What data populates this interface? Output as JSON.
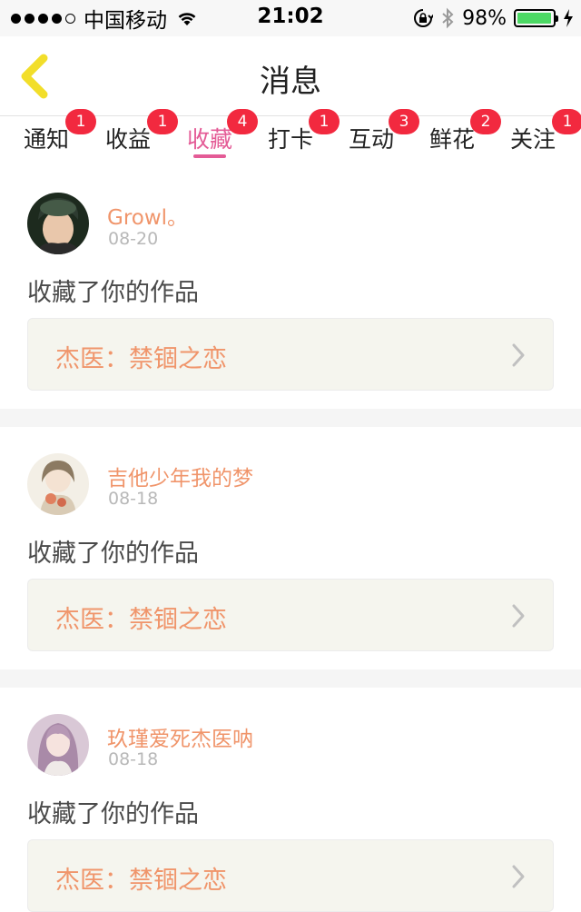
{
  "status_bar": {
    "carrier": "中国移动",
    "time": "21:02",
    "battery_percent": "98%",
    "battery_level": 0.98,
    "battery_color": "#4cd964"
  },
  "nav": {
    "title": "消息",
    "back_icon": "chevron-left-icon",
    "back_color": "#f2de2a"
  },
  "tabs": [
    {
      "label": "通知",
      "badge": "1"
    },
    {
      "label": "收益",
      "badge": "1"
    },
    {
      "label": "收藏",
      "badge": "4",
      "active": true
    },
    {
      "label": "打卡",
      "badge": "1"
    },
    {
      "label": "互动",
      "badge": "3"
    },
    {
      "label": "鲜花",
      "badge": "2"
    },
    {
      "label": "关注",
      "badge": "1"
    }
  ],
  "colors": {
    "accent": "#e45b96",
    "badge": "#f2293f",
    "username": "#f0956b",
    "card_bg": "#f5f5ee"
  },
  "messages": [
    {
      "username": "Growl。",
      "date": "08-20",
      "action": "收藏了你的作品",
      "work_title": "杰医：禁锢之恋"
    },
    {
      "username": "吉他少年我的梦",
      "date": "08-18",
      "action": "收藏了你的作品",
      "work_title": "杰医：禁锢之恋"
    },
    {
      "username": "玖瑾爱死杰医呐",
      "date": "08-18",
      "action": "收藏了你的作品",
      "work_title": "杰医：禁锢之恋"
    }
  ]
}
